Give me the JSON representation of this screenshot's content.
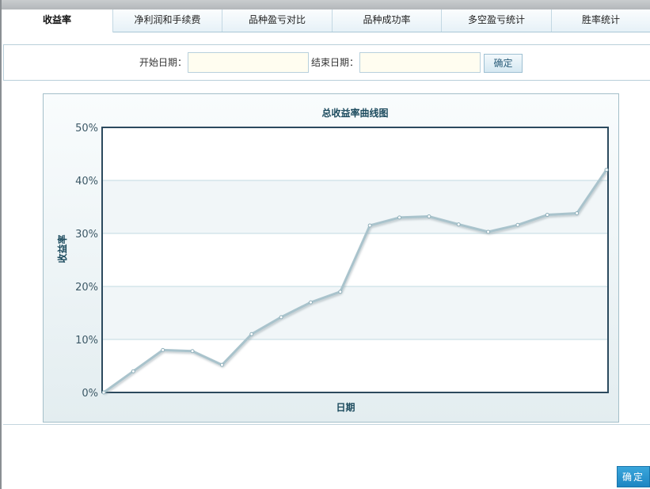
{
  "tabs": [
    {
      "label": "收益率",
      "active": true
    },
    {
      "label": "净利润和手续费",
      "active": false
    },
    {
      "label": "品种盈亏对比",
      "active": false
    },
    {
      "label": "品种成功率",
      "active": false
    },
    {
      "label": "多空盈亏统计",
      "active": false
    },
    {
      "label": "胜率统计",
      "active": false
    }
  ],
  "filter": {
    "start_label": "开始日期：",
    "start_value": "",
    "end_label": "结束日期：",
    "end_value": "",
    "confirm_label": "确定"
  },
  "footer": {
    "ok_label": "确定"
  },
  "colors": {
    "line": "#a9c3cc",
    "plot_border": "#2c4a5e",
    "title": "#1c4b5e"
  },
  "chart_data": {
    "type": "line",
    "title": "总收益率曲线图",
    "xlabel": "日期",
    "ylabel": "收益率",
    "ylim": [
      0,
      50
    ],
    "yticks": [
      "0%",
      "10%",
      "20%",
      "30%",
      "40%",
      "50%"
    ],
    "grid": true,
    "series": [
      {
        "values": [
          0,
          4,
          8,
          7.8,
          5.2,
          11,
          14.2,
          17,
          19,
          31.5,
          33,
          33.2,
          31.7,
          30.3,
          31.6,
          33.5,
          33.8,
          42
        ]
      }
    ]
  }
}
